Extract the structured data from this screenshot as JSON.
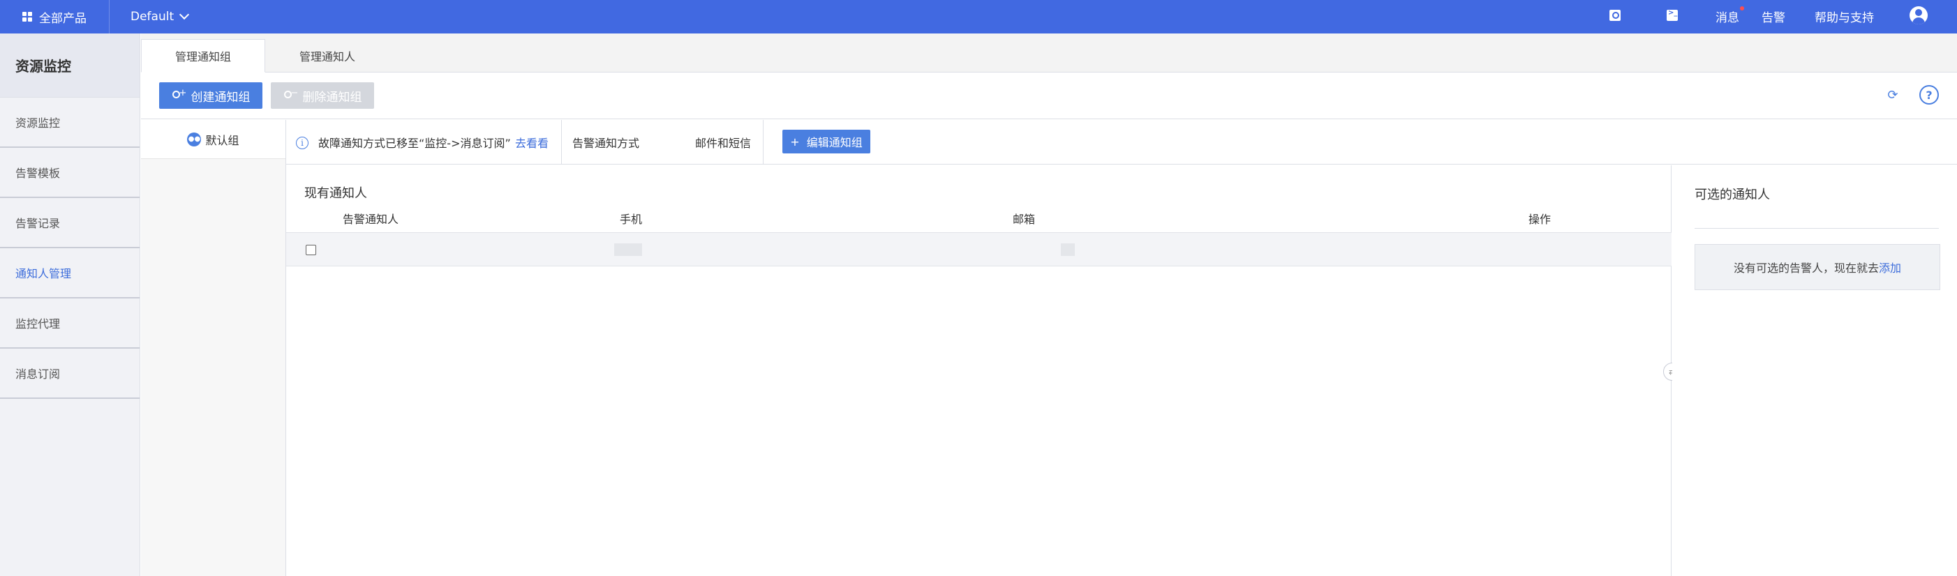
{
  "topbar": {
    "all_products": "全部产品",
    "region": "Default",
    "messages": "消息",
    "alarms": "告警",
    "help": "帮助与支持"
  },
  "sidebar": {
    "title": "资源监控",
    "items": [
      {
        "label": "资源监控"
      },
      {
        "label": "告警模板"
      },
      {
        "label": "告警记录"
      },
      {
        "label": "通知人管理",
        "active": true
      },
      {
        "label": "监控代理"
      },
      {
        "label": "消息订阅"
      }
    ]
  },
  "tabs": [
    {
      "label": "管理通知组",
      "active": true
    },
    {
      "label": "管理通知人"
    }
  ],
  "toolbar": {
    "create_label": "创建通知组",
    "delete_label": "删除通知组",
    "help_glyph": "?"
  },
  "groups": [
    {
      "label": "默认组"
    }
  ],
  "info": {
    "notice": "故障通知方式已移至“监控->消息订阅”",
    "notice_link": "去看看",
    "method_label": "告警通知方式",
    "method_value": "邮件和短信",
    "edit_label": "编辑通知组"
  },
  "table": {
    "title": "现有通知人",
    "columns": [
      "告警通知人",
      "手机",
      "邮箱",
      "操作"
    ]
  },
  "right_panel": {
    "title": "可选的通知人",
    "empty_text": "没有可选的告警人，现在就去",
    "empty_link": "添加"
  },
  "colors": {
    "topbar": "#4169e1",
    "primary": "#4a7fe0",
    "link": "#3d6ddb"
  }
}
